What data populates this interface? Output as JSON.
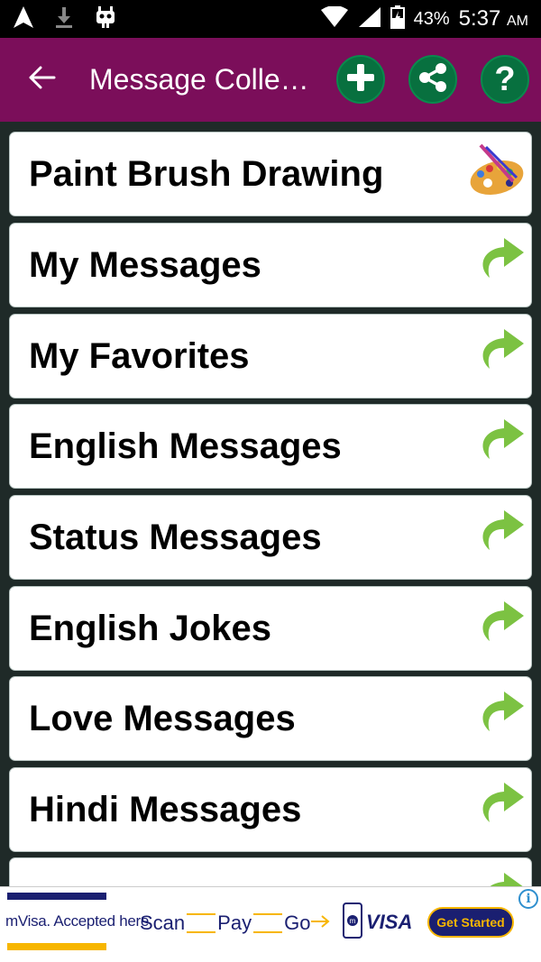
{
  "status_bar": {
    "battery": "43%",
    "time": "5:37",
    "ampm": "AM"
  },
  "app_bar": {
    "title": "Message Colle…"
  },
  "list": {
    "items": [
      {
        "label": "Paint Brush Drawing",
        "icon": "paint-palette-icon"
      },
      {
        "label": "My Messages",
        "icon": "green-arrow-icon"
      },
      {
        "label": "My Favorites",
        "icon": "green-arrow-icon"
      },
      {
        "label": "English Messages",
        "icon": "green-arrow-icon"
      },
      {
        "label": "Status Messages",
        "icon": "green-arrow-icon"
      },
      {
        "label": "English Jokes",
        "icon": "green-arrow-icon"
      },
      {
        "label": "Love Messages",
        "icon": "green-arrow-icon"
      },
      {
        "label": "Hindi Messages",
        "icon": "green-arrow-icon"
      },
      {
        "label": "",
        "icon": "green-arrow-icon"
      }
    ]
  },
  "ad": {
    "tagline": "mVisa. Accepted here.",
    "flow": [
      "Scan",
      "Pay",
      "Go"
    ],
    "brand": "VISA",
    "cta": "Get Started",
    "info": "i"
  },
  "colors": {
    "app_bar": "#7b0e5a",
    "action_button": "#08703f",
    "arrow": "#7cc242",
    "list_bg": "#1f2a28"
  }
}
